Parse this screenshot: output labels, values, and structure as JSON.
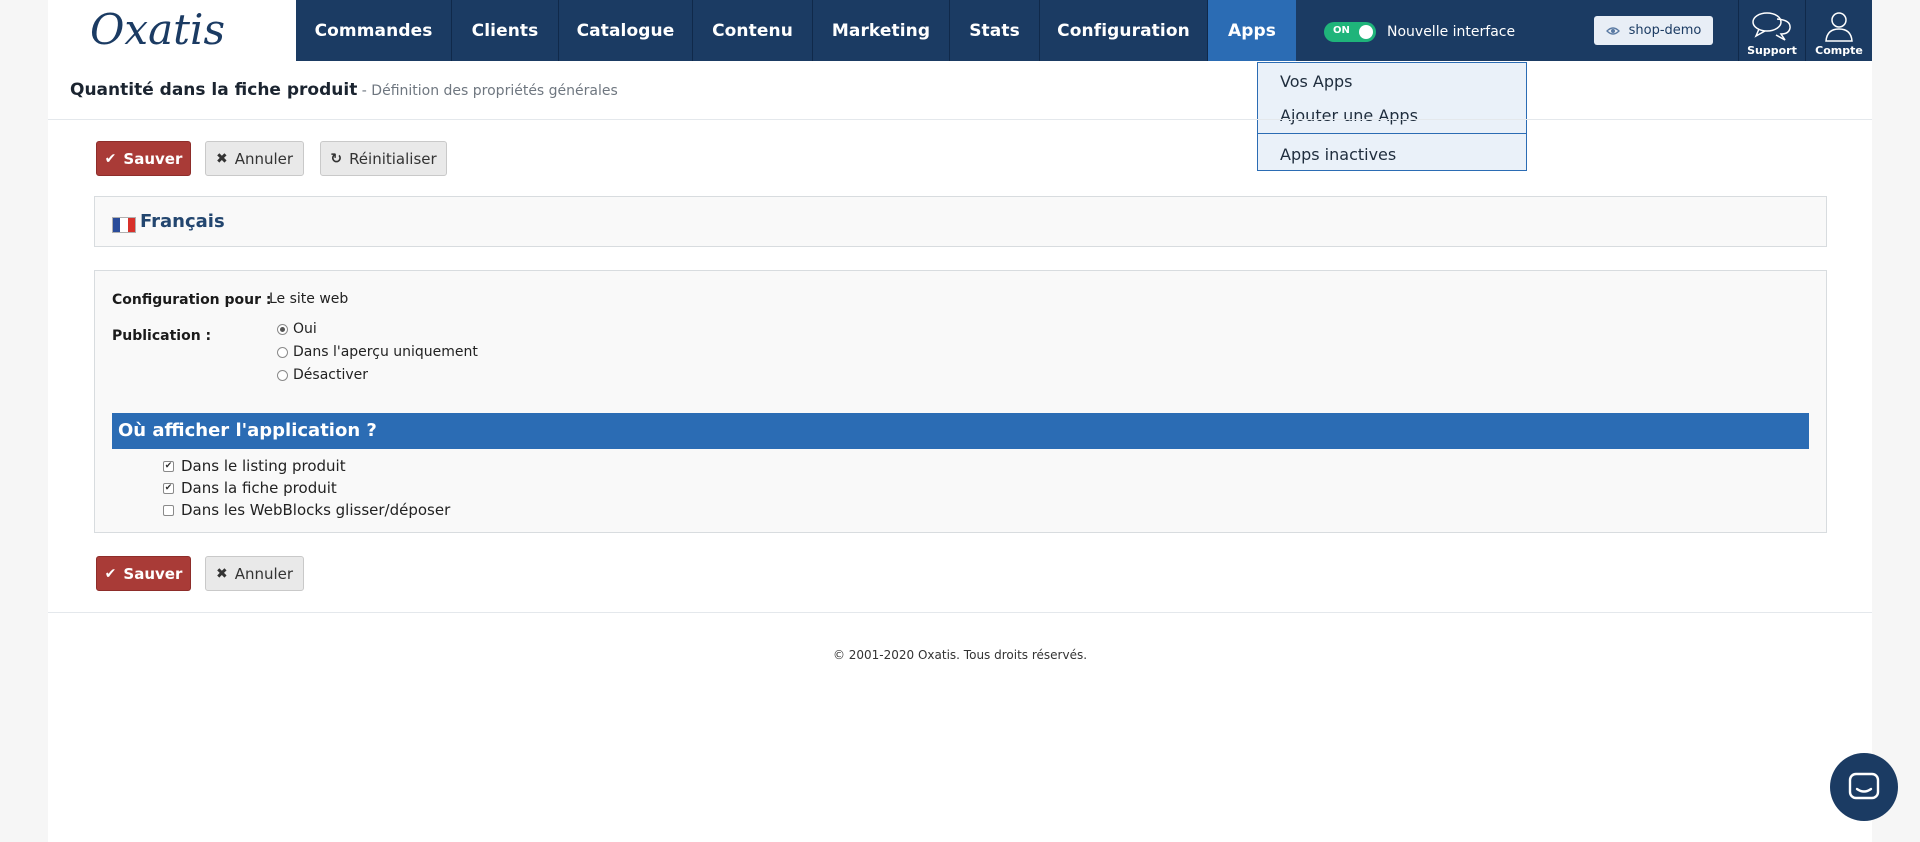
{
  "header": {
    "logo_text": "Oxatis",
    "nav": [
      "Commandes",
      "Clients",
      "Catalogue",
      "Contenu",
      "Marketing",
      "Stats",
      "Configuration",
      "Apps"
    ],
    "active_nav": "Apps",
    "toggle": {
      "state": "ON",
      "label": "Nouvelle interface"
    },
    "shop_button": "shop-demo",
    "support_label": "Support",
    "account_label": "Compte"
  },
  "apps_menu": {
    "items": [
      "Vos Apps",
      "Ajouter une Apps",
      "Apps inactives"
    ]
  },
  "page": {
    "title": "Quantité dans la fiche produit",
    "subtitle": " - Définition des propriétés générales"
  },
  "toolbar": {
    "save_label": "Sauver",
    "cancel_label": "Annuler",
    "reset_label": "Réinitialiser"
  },
  "language": {
    "label": "Français"
  },
  "config": {
    "config_for_label": "Configuration pour :",
    "config_for_value": "Le site web",
    "publication_label": "Publication :",
    "publication_options": [
      "Oui",
      "Dans l'aperçu uniquement",
      "Désactiver"
    ],
    "publication_selected": "Oui",
    "section_title": "Où afficher l'application ?",
    "display_options": [
      {
        "label": "Dans le listing produit",
        "checked": true
      },
      {
        "label": "Dans la fiche produit",
        "checked": true
      },
      {
        "label": "Dans les WebBlocks glisser/déposer",
        "checked": false
      }
    ]
  },
  "footer": {
    "copyright": "© 2001-2020 Oxatis. Tous droits réservés."
  },
  "colors": {
    "navbar": "#1b3b63",
    "active_tab": "#2b6cb4",
    "save_button": "#a93b37",
    "toggle_on": "#1fb47a",
    "section_header": "#2b6cb4"
  },
  "icons": {
    "logo": "oxatis-logo",
    "support": "speech-bubbles-icon",
    "account": "user-icon",
    "shop": "eye-icon",
    "save": "check-icon",
    "cancel": "x-icon",
    "reset": "refresh-icon",
    "chat": "chat-icon"
  }
}
